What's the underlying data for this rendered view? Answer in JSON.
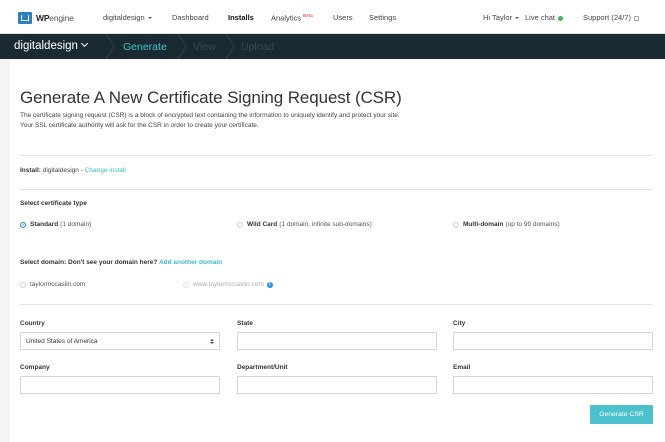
{
  "topnav": {
    "logo_bold": "WP",
    "logo_light": "engine",
    "site_menu": "digitaldesign",
    "dashboard": "Dashboard",
    "installs": "Installs",
    "analytics": "Analytics",
    "analytics_badge": "Beta",
    "users": "Users",
    "settings": "Settings",
    "user_menu": "Hi Taylor",
    "live_chat": "Live chat",
    "support": "Support (24/7)"
  },
  "breadcrumb": {
    "site": "digitaldesign",
    "generate": "Generate",
    "view": "View",
    "upload": "Upload"
  },
  "page": {
    "title": "Generate A New Certificate Signing Request (CSR)",
    "desc_line1": "The certificate signing request (CSR) is a block of encrypted text containing the information to uniquely identify and protect your site.",
    "desc_line2": "Your SSL certificate authority will ask for the CSR in order to create your certificate."
  },
  "install": {
    "label": "Install:",
    "name": "digitaldesign",
    "separator": " - ",
    "change_link": "Change install"
  },
  "cert_type": {
    "label": "Select certificate type",
    "options": [
      {
        "name": "Standard",
        "detail": "(1 domain)",
        "selected": true
      },
      {
        "name": "Wild Card",
        "detail": "(1 domain, infinite sub-domains)",
        "selected": false
      },
      {
        "name": "Multi-domain",
        "detail": "(up to 99 domains)",
        "selected": false
      }
    ]
  },
  "domain": {
    "label": "Select domain: Don't see your domain here?",
    "add_link": "Add another domain",
    "options": [
      {
        "name": "taylormccaslin.com",
        "disabled": false
      },
      {
        "name": "www.taylormccaslin.com",
        "disabled": true
      }
    ]
  },
  "form": {
    "country_label": "Country",
    "country_value": "United States of America",
    "state_label": "State",
    "state_value": "",
    "city_label": "City",
    "city_value": "",
    "company_label": "Company",
    "company_value": "",
    "department_label": "Department/Unit",
    "department_value": "",
    "email_label": "Email",
    "email_value": ""
  },
  "actions": {
    "generate_button": "Generate CSR"
  },
  "colors": {
    "brand_blue": "#2d7fc1",
    "crumbbar_bg": "#192a33",
    "accent_teal": "#40c4d0",
    "button": "#4cc1cd",
    "live_dot": "#3fb55b"
  }
}
